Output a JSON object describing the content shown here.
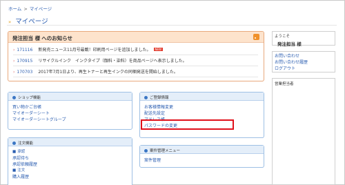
{
  "breadcrumb": {
    "home": "ホーム",
    "sep": ">",
    "current": "マイページ"
  },
  "page_title": "マイページ",
  "news": {
    "heading_prefix": "発注担当 様",
    "heading_suffix": "へのお知らせ",
    "items": [
      {
        "date": "171116",
        "text": "新発売ニュース11月号最載！印刷用ページを追加しました。",
        "badge": "NEW"
      },
      {
        "date": "170915",
        "text": "リサイクルインク　インクタイプ（顔料・染料）を商品ページへ表示しました。",
        "badge": ""
      },
      {
        "date": "170703",
        "text": "2017年7月1日より、再生トナーと再生インクの同梱発送を開始しました。",
        "badge": ""
      }
    ]
  },
  "sidebar": {
    "welcome": "ようこそ",
    "user": "発注担当 様",
    "links": [
      "お問い合わせ",
      "お問い合わせ履歴",
      "ログアウト"
    ],
    "rep_label": "営業担当者"
  },
  "shop_panel": {
    "title": "ショップ機能",
    "links": [
      "買い物かご台帳",
      "マイオーダーシート",
      "マイオーダーシートグループ"
    ]
  },
  "registration_panel": {
    "title": "ご登録情報",
    "links": [
      "お客様情報変更",
      "配送先設定",
      "アドレス帳",
      "パスワードの変更"
    ]
  },
  "order_panel": {
    "title": "注文機能",
    "items": [
      {
        "label": "承認",
        "type": "section"
      },
      {
        "label": "承認待ち",
        "type": "link"
      },
      {
        "label": "承認依頼履歴",
        "type": "link"
      },
      {
        "label": "注文",
        "type": "section"
      },
      {
        "label": "購入履歴",
        "type": "link"
      }
    ]
  },
  "case_panel": {
    "title": "案件管理メニュー",
    "links": [
      "案件管理"
    ]
  },
  "colors": {
    "link": "#2a5db0",
    "news_header": "#fde3cc",
    "panel_header": "#e4eef9",
    "highlight": "#e0101a"
  }
}
